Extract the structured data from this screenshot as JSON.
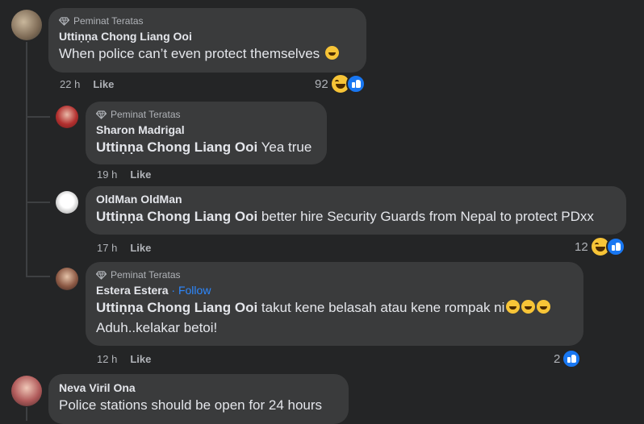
{
  "badge_label": "Peminat Teratas",
  "comments": [
    {
      "author": "Uttiṇṇa Chong Liang Ooi",
      "text": "When police can’t even protect themselves",
      "time": "22 h",
      "like": "Like",
      "reactions": "92"
    },
    {
      "author": "Sharon Madrigal",
      "mention": "Uttiṇṇa Chong Liang Ooi",
      "text": " Yea true",
      "time": "19 h",
      "like": "Like"
    },
    {
      "author": "OldMan OldMan",
      "mention": "Uttiṇṇa Chong Liang Ooi",
      "text": " better hire Security Guards from Nepal to protect PDxx",
      "time": "17 h",
      "like": "Like",
      "reactions": "12"
    },
    {
      "author": "Estera Estera",
      "follow": "Follow",
      "mention": "Uttiṇṇa Chong Liang Ooi",
      "text": " takut kene belasah atau kene rompak ni",
      "text2": "Aduh..kelakar betoi!",
      "time": "12 h",
      "like": "Like",
      "reactions": "2"
    },
    {
      "author": "Neva Viril Ona",
      "text": "Police stations should be open for 24 hours"
    }
  ]
}
